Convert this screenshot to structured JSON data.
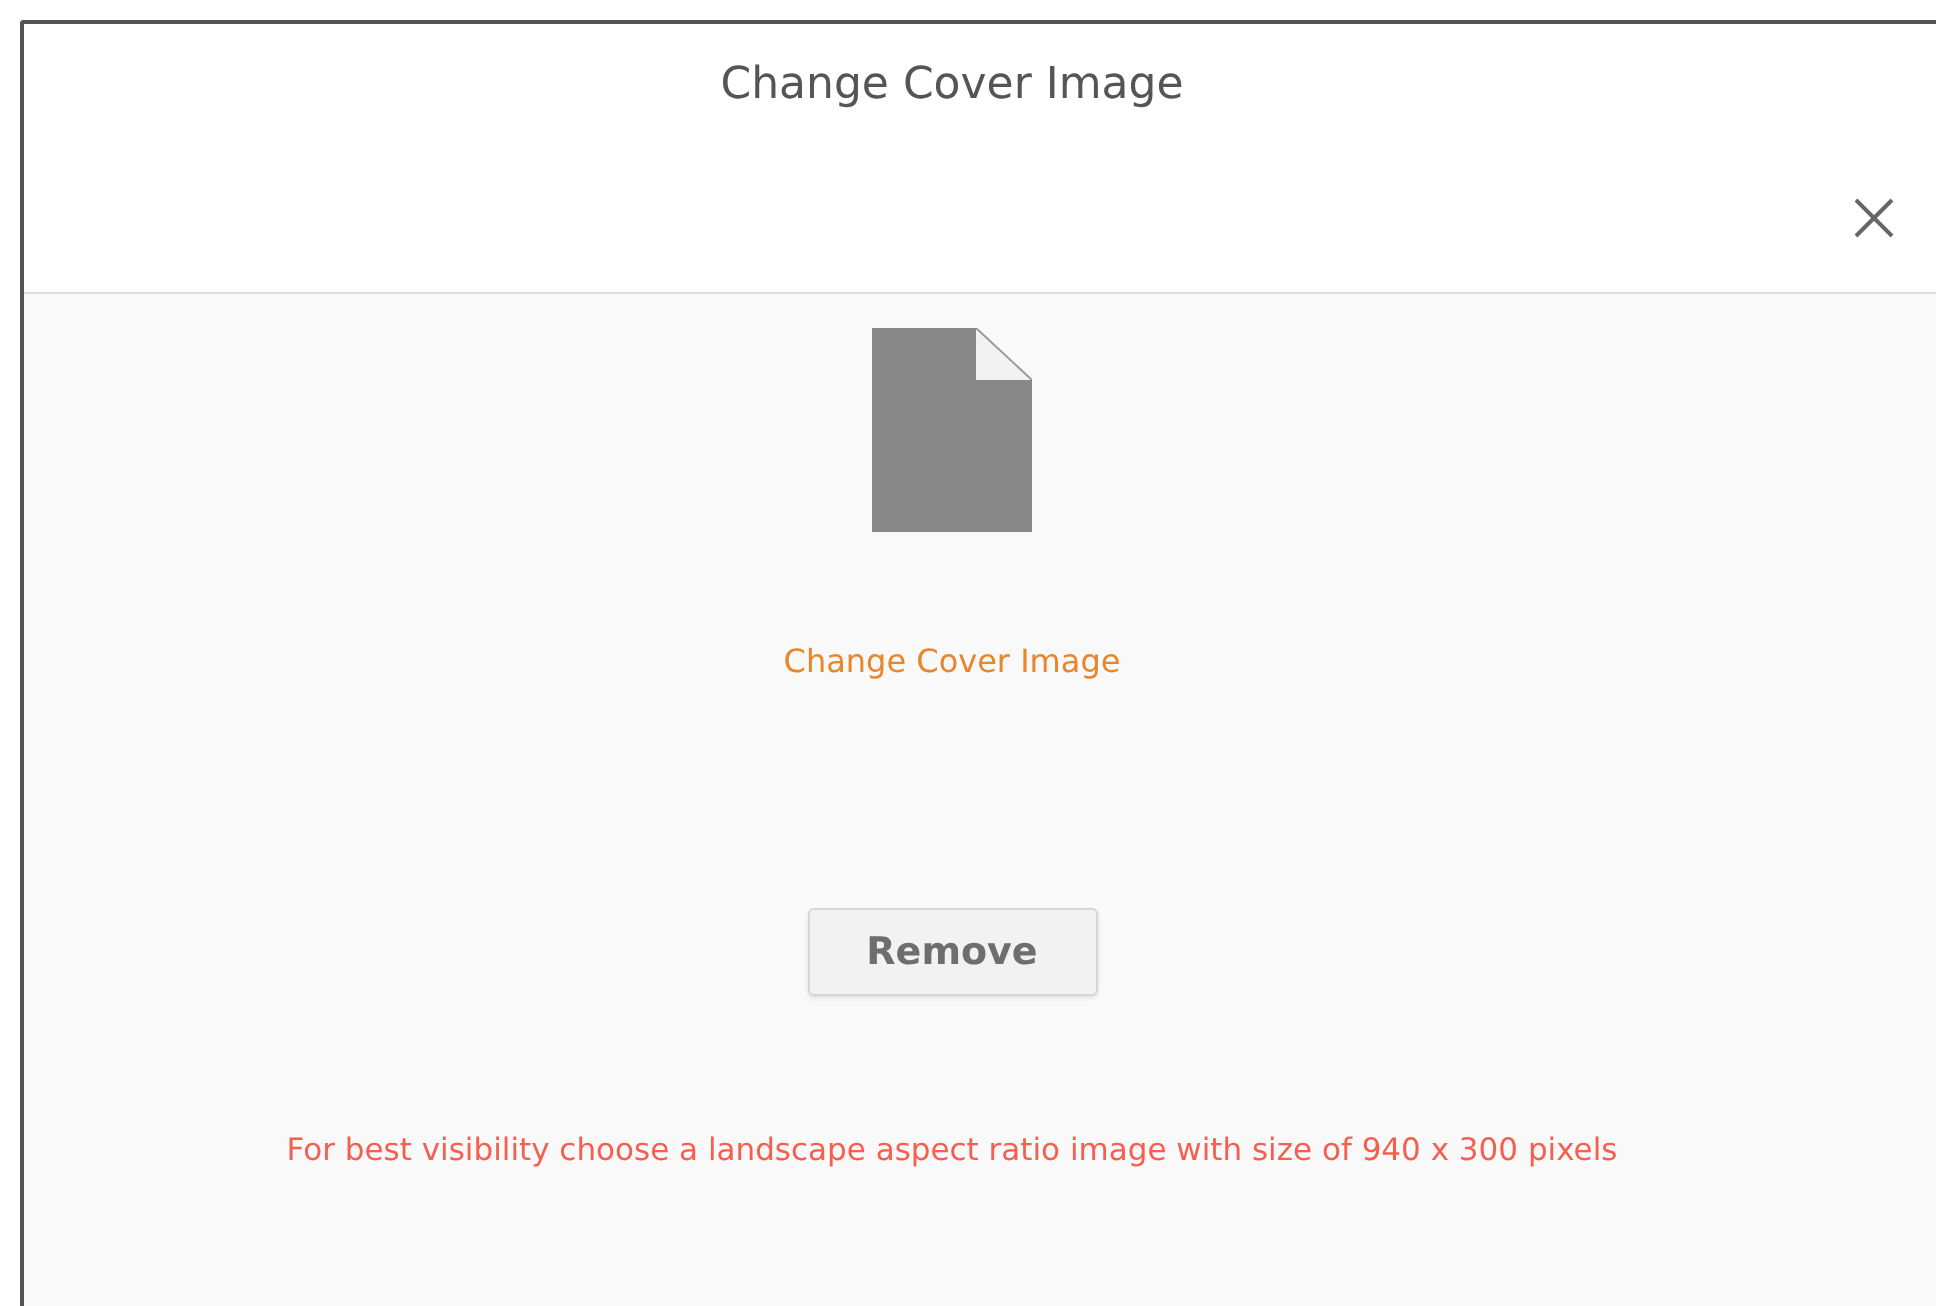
{
  "dialog": {
    "title": "Change Cover Image"
  },
  "cover": {
    "link": "Change Cover Image"
  },
  "buttons": [
    {
      "label": "Remove"
    }
  ],
  "hint": "For best visibility choose a landscape aspect ratio image with size of 940 x 300 pixels"
}
